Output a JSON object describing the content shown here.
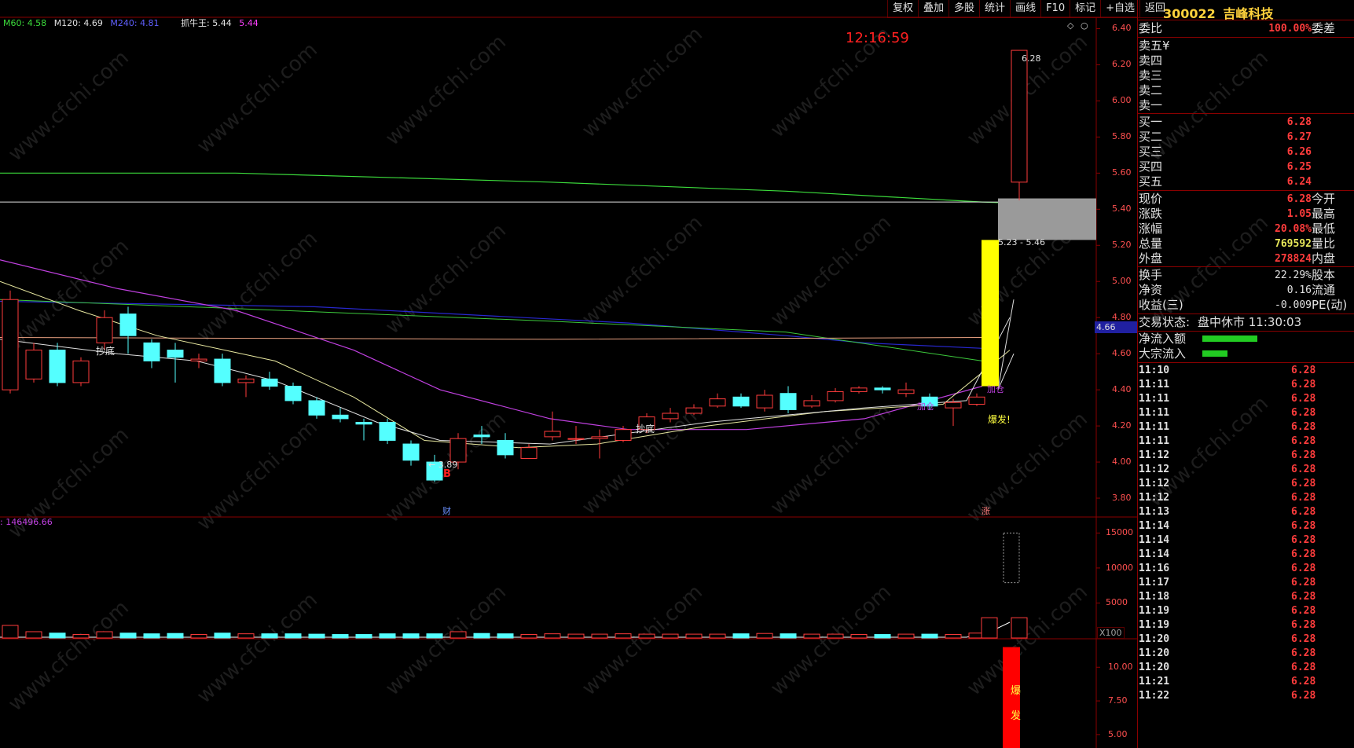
{
  "indicators": {
    "ma60": "M60: 4.58",
    "ma120": "M120: 4.69",
    "ma240": "M240: 4.81",
    "zhuaniu_label": "抓牛王: 5.44",
    "zhuaniu_val": "5.44"
  },
  "clock": "12:16:59",
  "toolbar": [
    "复权",
    "叠加",
    "多股",
    "统计",
    "画线",
    "F10",
    "标记",
    "+自选",
    "返回"
  ],
  "stock": {
    "code": "300022",
    "name": "吉峰科技"
  },
  "order_book": {
    "weibi_label": "委比",
    "weibi_value": "100.00%",
    "weicha_label": "委差",
    "sells": [
      {
        "label": "卖五",
        "price": ""
      },
      {
        "label": "卖四",
        "price": ""
      },
      {
        "label": "卖三",
        "price": ""
      },
      {
        "label": "卖二",
        "price": ""
      },
      {
        "label": "卖一",
        "price": ""
      }
    ],
    "sell5_currency": "¥",
    "buys": [
      {
        "label": "买一",
        "price": "6.28"
      },
      {
        "label": "买二",
        "price": "6.27"
      },
      {
        "label": "买三",
        "price": "6.26"
      },
      {
        "label": "买四",
        "price": "6.25"
      },
      {
        "label": "买五",
        "price": "6.24"
      }
    ]
  },
  "quote": [
    {
      "label": "现价",
      "value": "6.28",
      "label2": "今开",
      "color": "#ff3c3c"
    },
    {
      "label": "涨跌",
      "value": "1.05",
      "label2": "最高",
      "color": "#ff3c3c"
    },
    {
      "label": "涨幅",
      "value": "20.08%",
      "label2": "最低",
      "color": "#ff3c3c"
    },
    {
      "label": "总量",
      "value": "769592",
      "label2": "量比",
      "color": "#e8e85a"
    },
    {
      "label": "外盘",
      "value": "278824",
      "label2": "内盘",
      "color": "#ff3c3c"
    }
  ],
  "fundamentals": [
    {
      "label": "换手",
      "value": "22.29%",
      "label2": "股本"
    },
    {
      "label": "净资",
      "value": "0.16",
      "label2": "流通"
    },
    {
      "label": "收益(三)",
      "value": "-0.009",
      "label2": "PE(动)"
    }
  ],
  "trade_status": {
    "label": "交易状态:",
    "value": "盘中休市 11:30:03"
  },
  "flows": [
    {
      "label": "净流入额",
      "bar": 0.7
    },
    {
      "label": "大宗流入",
      "bar": 0.32
    }
  ],
  "ticks": [
    {
      "time": "11:10",
      "price": "6.28"
    },
    {
      "time": "11:11",
      "price": "6.28"
    },
    {
      "time": "11:11",
      "price": "6.28"
    },
    {
      "time": "11:11",
      "price": "6.28"
    },
    {
      "time": "11:11",
      "price": "6.28"
    },
    {
      "time": "11:11",
      "price": "6.28"
    },
    {
      "time": "11:12",
      "price": "6.28"
    },
    {
      "time": "11:12",
      "price": "6.28"
    },
    {
      "time": "11:12",
      "price": "6.28"
    },
    {
      "time": "11:12",
      "price": "6.28"
    },
    {
      "time": "11:13",
      "price": "6.28"
    },
    {
      "time": "11:14",
      "price": "6.28"
    },
    {
      "time": "11:14",
      "price": "6.28"
    },
    {
      "time": "11:14",
      "price": "6.28"
    },
    {
      "time": "11:16",
      "price": "6.28"
    },
    {
      "time": "11:17",
      "price": "6.28"
    },
    {
      "time": "11:18",
      "price": "6.28"
    },
    {
      "time": "11:19",
      "price": "6.28"
    },
    {
      "time": "11:19",
      "price": "6.28"
    },
    {
      "time": "11:20",
      "price": "6.28"
    },
    {
      "time": "11:20",
      "price": "6.28"
    },
    {
      "time": "11:20",
      "price": "6.28"
    },
    {
      "time": "11:21",
      "price": "6.28"
    },
    {
      "time": "11:22",
      "price": "6.28"
    }
  ],
  "price_axis": [
    "6.40",
    "6.20",
    "6.00",
    "5.80",
    "5.60",
    "5.40",
    "5.20",
    "5.00",
    "4.80",
    "4.60",
    "4.40",
    "4.20",
    "4.00",
    "3.80"
  ],
  "price_current_tag": "4.66",
  "volume_axis": [
    "15000",
    "10000",
    "5000"
  ],
  "volume_unit": "X100",
  "volume_title": ": 146496.66",
  "signal_axis": [
    "10.00",
    "7.50",
    "5.00"
  ],
  "annotations": {
    "chaodi1": "抄底",
    "chaodi2": "抄底",
    "jiacang1": "加仓",
    "jiacang2": "加仓",
    "baofa": "爆发!",
    "low_marker": "3.89",
    "buy_marker": "B",
    "high_marker": "6.28",
    "range": "5.23 - 5.46",
    "cai": "财",
    "zhang": "涨",
    "signal_bar_1": "爆",
    "signal_bar_2": "发"
  },
  "watermark": "www.cfchi.com",
  "colors": {
    "up": "#ff3c3c",
    "down": "#54ffff",
    "ma_green": "#3cdc3c",
    "ma_blue": "#2828d0",
    "ma_magenta": "#c040e0",
    "ma_yellow": "#e8e8a0",
    "highlight_yellow": "#ffff00"
  },
  "chart_data": {
    "type": "candlestick",
    "ylim": [
      3.7,
      6.45
    ],
    "candles": [
      {
        "o": 4.4,
        "c": 4.9,
        "h": 4.95,
        "l": 4.38
      },
      {
        "o": 4.46,
        "c": 4.62,
        "h": 4.66,
        "l": 4.44
      },
      {
        "o": 4.62,
        "c": 4.44,
        "h": 4.66,
        "l": 4.42
      },
      {
        "o": 4.44,
        "c": 4.56,
        "h": 4.58,
        "l": 4.42
      },
      {
        "o": 4.66,
        "c": 4.8,
        "h": 4.84,
        "l": 4.62
      },
      {
        "o": 4.82,
        "c": 4.7,
        "h": 4.86,
        "l": 4.6
      },
      {
        "o": 4.66,
        "c": 4.56,
        "h": 4.68,
        "l": 4.52
      },
      {
        "o": 4.62,
        "c": 4.58,
        "h": 4.66,
        "l": 4.44
      },
      {
        "o": 4.56,
        "c": 4.57,
        "h": 4.6,
        "l": 4.52
      },
      {
        "o": 4.57,
        "c": 4.44,
        "h": 4.6,
        "l": 4.42
      },
      {
        "o": 4.44,
        "c": 4.46,
        "h": 4.48,
        "l": 4.36
      },
      {
        "o": 4.46,
        "c": 4.42,
        "h": 4.5,
        "l": 4.4
      },
      {
        "o": 4.42,
        "c": 4.34,
        "h": 4.44,
        "l": 4.32
      },
      {
        "o": 4.34,
        "c": 4.26,
        "h": 4.36,
        "l": 4.24
      },
      {
        "o": 4.26,
        "c": 4.24,
        "h": 4.3,
        "l": 4.22
      },
      {
        "o": 4.22,
        "c": 4.21,
        "h": 4.24,
        "l": 4.12
      },
      {
        "o": 4.22,
        "c": 4.12,
        "h": 4.24,
        "l": 4.1
      },
      {
        "o": 4.1,
        "c": 4.01,
        "h": 4.12,
        "l": 3.98
      },
      {
        "o": 4.0,
        "c": 3.9,
        "h": 4.04,
        "l": 3.89
      },
      {
        "o": 4.0,
        "c": 4.13,
        "h": 4.16,
        "l": 3.96
      },
      {
        "o": 4.15,
        "c": 4.14,
        "h": 4.2,
        "l": 4.1
      },
      {
        "o": 4.12,
        "c": 4.04,
        "h": 4.16,
        "l": 4.02
      },
      {
        "o": 4.02,
        "c": 4.08,
        "h": 4.1,
        "l": 4.02
      },
      {
        "o": 4.14,
        "c": 4.17,
        "h": 4.28,
        "l": 4.12
      },
      {
        "o": 4.13,
        "c": 4.13,
        "h": 4.2,
        "l": 4.1
      },
      {
        "o": 4.13,
        "c": 4.14,
        "h": 4.18,
        "l": 4.02
      },
      {
        "o": 4.12,
        "c": 4.18,
        "h": 4.2,
        "l": 4.11
      },
      {
        "o": 4.18,
        "c": 4.25,
        "h": 4.27,
        "l": 4.16
      },
      {
        "o": 4.24,
        "c": 4.27,
        "h": 4.3,
        "l": 4.22
      },
      {
        "o": 4.27,
        "c": 4.3,
        "h": 4.32,
        "l": 4.26
      },
      {
        "o": 4.31,
        "c": 4.35,
        "h": 4.38,
        "l": 4.3
      },
      {
        "o": 4.36,
        "c": 4.31,
        "h": 4.38,
        "l": 4.3
      },
      {
        "o": 4.3,
        "c": 4.37,
        "h": 4.4,
        "l": 4.28
      },
      {
        "o": 4.38,
        "c": 4.29,
        "h": 4.42,
        "l": 4.27
      },
      {
        "o": 4.31,
        "c": 4.34,
        "h": 4.37,
        "l": 4.3
      },
      {
        "o": 4.34,
        "c": 4.39,
        "h": 4.41,
        "l": 4.33
      },
      {
        "o": 4.39,
        "c": 4.41,
        "h": 4.42,
        "l": 4.38
      },
      {
        "o": 4.41,
        "c": 4.4,
        "h": 4.42,
        "l": 4.38
      },
      {
        "o": 4.38,
        "c": 4.4,
        "h": 4.44,
        "l": 4.36
      },
      {
        "o": 4.36,
        "c": 4.31,
        "h": 4.38,
        "l": 4.29
      },
      {
        "o": 4.3,
        "c": 4.33,
        "h": 4.35,
        "l": 4.2
      },
      {
        "o": 4.32,
        "c": 4.36,
        "h": 4.38,
        "l": 4.31
      },
      {
        "o": 5.55,
        "c": 6.28,
        "h": 6.28,
        "l": 5.45
      }
    ],
    "volumes": [
      1800,
      900,
      700,
      500,
      900,
      700,
      600,
      650,
      500,
      700,
      600,
      600,
      600,
      550,
      500,
      500,
      600,
      600,
      600,
      900,
      650,
      600,
      500,
      600,
      550,
      550,
      600,
      550,
      550,
      550,
      550,
      600,
      650,
      600,
      550,
      550,
      500,
      500,
      550,
      550,
      500,
      700,
      2900,
      7900,
      15000
    ],
    "volume_ylim": [
      0,
      16500
    ],
    "signal_axis_range": [
      4.0,
      12.0
    ]
  }
}
